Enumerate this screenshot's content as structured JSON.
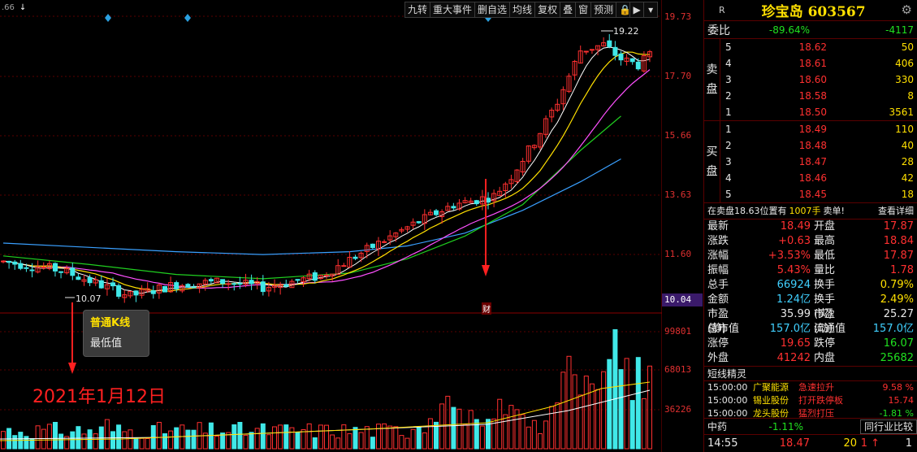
{
  "top_left": {
    "value": ".66",
    "arrow": "↓"
  },
  "toolbar": {
    "items": [
      "九转",
      "重大事件",
      "删自选",
      "均线",
      "复权",
      "叠",
      "窗",
      "预测"
    ],
    "lock_icon": "🔒",
    "play_icon": "▶",
    "dropdown_icon": "▾"
  },
  "chart": {
    "price_axis": [
      "19.73",
      "17.70",
      "15.66",
      "13.63",
      "11.60",
      "10.04"
    ],
    "volume_axis": [
      "99801",
      "68013",
      "36226"
    ],
    "high_label": "19.22",
    "low_label": "10.07",
    "event_marker": "财",
    "tooltip_title": "普通K线",
    "tooltip_value": "最低值",
    "annotation": "2021年1月12日",
    "colors": {
      "up": "#ff3030",
      "down": "#40e8e8",
      "ma5": "#ffffff",
      "ma10": "#ffe000",
      "ma20": "#ff50ff",
      "ma30": "#20d020",
      "ma60": "#3aa0ff",
      "grid": "#5a0000"
    }
  },
  "panel": {
    "market_tag": "R",
    "stock_name": "珍宝岛",
    "stock_code": "603567",
    "gear_icon": "⚙",
    "weibi": {
      "label": "委比",
      "pct": "-89.64%",
      "diff": "-4117"
    },
    "sell": {
      "side_label": [
        "卖",
        "盘"
      ],
      "levels": [
        {
          "lvl": "5",
          "price": "18.62",
          "qty": "50"
        },
        {
          "lvl": "4",
          "price": "18.61",
          "qty": "406"
        },
        {
          "lvl": "3",
          "price": "18.60",
          "qty": "330"
        },
        {
          "lvl": "2",
          "price": "18.58",
          "qty": "8"
        },
        {
          "lvl": "1",
          "price": "18.50",
          "qty": "3561"
        }
      ]
    },
    "buy": {
      "side_label": [
        "买",
        "盘"
      ],
      "levels": [
        {
          "lvl": "1",
          "price": "18.49",
          "qty": "110"
        },
        {
          "lvl": "2",
          "price": "18.48",
          "qty": "40"
        },
        {
          "lvl": "3",
          "price": "18.47",
          "qty": "28"
        },
        {
          "lvl": "4",
          "price": "18.46",
          "qty": "42"
        },
        {
          "lvl": "5",
          "price": "18.45",
          "qty": "18"
        }
      ]
    },
    "position": {
      "text": "在卖盘18.63位置有",
      "qty": "1007手",
      "action": "卖单!",
      "detail": "查看详细"
    },
    "stats": [
      {
        "k1": "最新",
        "v1": "18.49",
        "c1": "red",
        "k2": "开盘",
        "v2": "17.87",
        "c2": "red"
      },
      {
        "k1": "涨跌",
        "v1": "+0.63",
        "c1": "red",
        "k2": "最高",
        "v2": "18.84",
        "c2": "red"
      },
      {
        "k1": "涨幅",
        "v1": "+3.53%",
        "c1": "red",
        "k2": "最低",
        "v2": "17.87",
        "c2": "red"
      },
      {
        "k1": "振幅",
        "v1": "5.43%",
        "c1": "red",
        "k2": "量比",
        "v2": "1.78",
        "c2": "red"
      },
      {
        "k1": "总手",
        "v1": "66924",
        "c1": "cyan",
        "k2": "换手",
        "v2": "0.79%",
        "c2": "yellow"
      },
      {
        "k1": "金额",
        "v1": "1.24亿",
        "c1": "cyan",
        "k2": "换手(实)",
        "v2": "2.49%",
        "c2": "yellow"
      },
      {
        "k1": "市盈(静)",
        "v1": "35.99",
        "c1": "white",
        "k2": "市盈(动)",
        "v2": "25.27",
        "c2": "white"
      },
      {
        "k1": "总市值",
        "v1": "157.0亿",
        "c1": "cyan",
        "k2": "流通值",
        "v2": "157.0亿",
        "c2": "cyan"
      },
      {
        "k1": "涨停",
        "v1": "19.65",
        "c1": "red",
        "k2": "跌停",
        "v2": "16.07",
        "c2": "green"
      },
      {
        "k1": "外盘",
        "v1": "41242",
        "c1": "red",
        "k2": "内盘",
        "v2": "25682",
        "c2": "green"
      }
    ],
    "sprite": {
      "title": "短线精灵",
      "items": [
        {
          "time": "15:00:00",
          "name": "广聚能源",
          "event": "急速拉升",
          "pct": "9.58 %",
          "pcolor": "red"
        },
        {
          "time": "15:00:00",
          "name": "锡业股份",
          "event": "打开跌停板",
          "pct": "15.74",
          "pcolor": "red"
        },
        {
          "time": "15:00:00",
          "name": "龙头股份",
          "event": "猛烈打压",
          "pct": "-1.81 %",
          "pcolor": "green"
        }
      ]
    },
    "sector": {
      "name": "中药",
      "pct": "-1.11%",
      "compare": "同行业比较"
    },
    "tick": {
      "time": "14:55",
      "price": "18.47",
      "vol": "20",
      "dir": "1 ↑",
      "count": "1"
    }
  }
}
